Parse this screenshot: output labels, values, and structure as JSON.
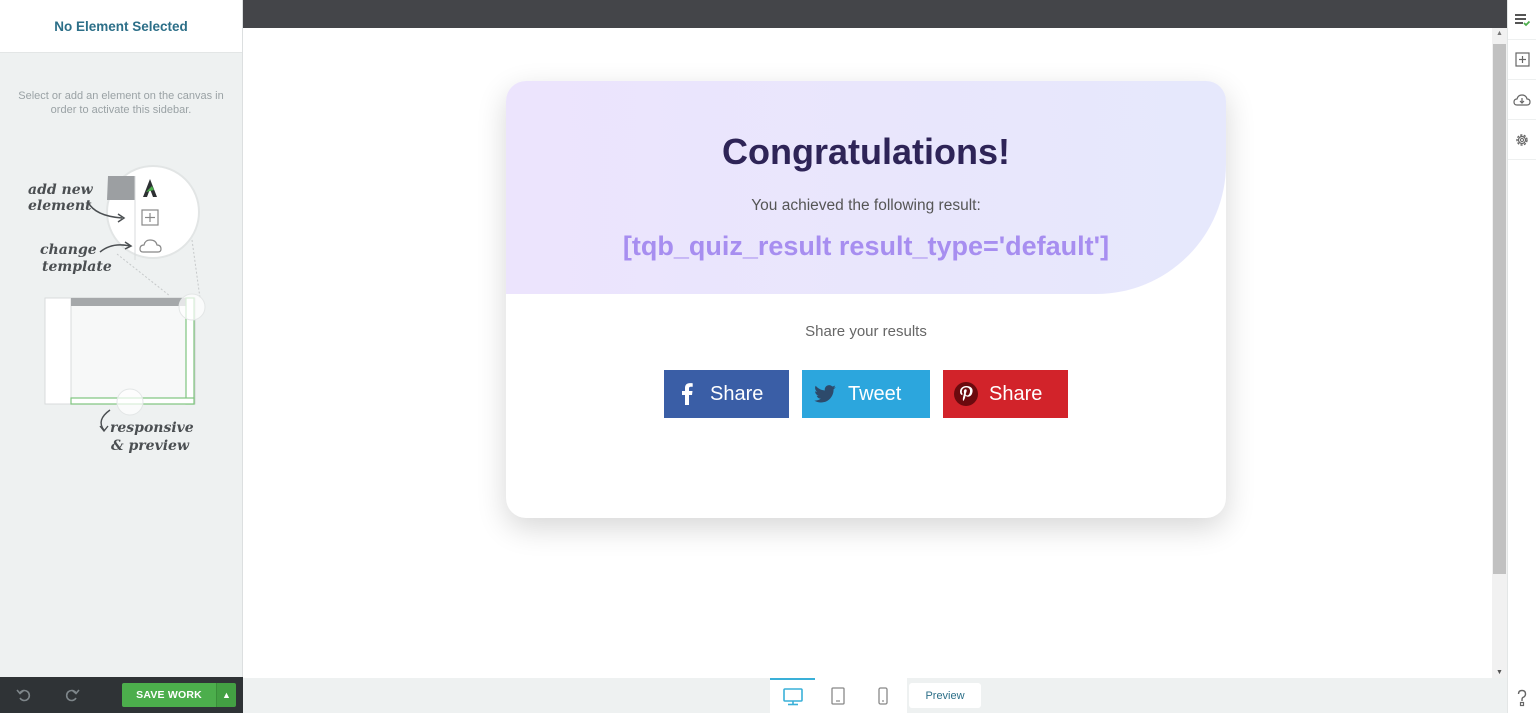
{
  "sidebar": {
    "title": "No Element Selected",
    "help_text": "Select or add an element on the canvas in order to activate this sidebar.",
    "illustration": {
      "label_add": [
        "add new",
        "element"
      ],
      "label_change": [
        "change",
        "template"
      ],
      "label_responsive": [
        "responsive",
        "& preview"
      ]
    },
    "save_label": "SAVE WORK"
  },
  "card": {
    "title": "Congratulations!",
    "subtitle": "You achieved the following result:",
    "result_shortcode": "[tqb_quiz_result result_type='default']",
    "share_heading": "Share your results",
    "share_buttons": [
      {
        "network": "facebook",
        "label": "Share",
        "color": "#3a5ea6",
        "icon": "facebook-icon"
      },
      {
        "network": "twitter",
        "label": "Tweet",
        "color": "#2ca6dd",
        "icon": "twitter-icon"
      },
      {
        "network": "pinterest",
        "label": "Share",
        "color": "#d2232a",
        "icon": "pinterest-icon"
      }
    ]
  },
  "bottom_bar": {
    "devices": [
      "desktop-icon",
      "tablet-icon",
      "mobile-icon"
    ],
    "preview_label": "Preview"
  },
  "right_rail": {
    "icons": [
      "element-list-icon",
      "add-element-icon",
      "cloud-template-icon",
      "settings-gear-icon",
      "help-icon"
    ]
  },
  "colors": {
    "accent": "#2c6f88",
    "save_green": "#4cae4c",
    "title_dark": "#2e2457",
    "result_purple": "#a78ef0"
  }
}
